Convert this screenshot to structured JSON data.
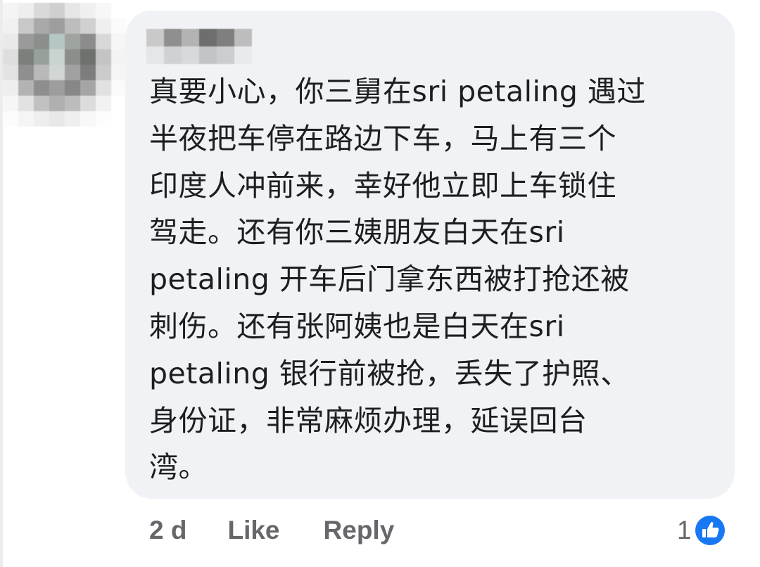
{
  "comment": {
    "lines": [
      "真要小心，你三舅在sri petaling 遇过",
      "半夜把车停在路边下车，马上有三个",
      "印度人冲前来，幸好他立即上车锁住",
      "驾走。还有你三姨朋友白天在sri",
      "petaling 开车后门拿东西被打抢还被",
      "刺伤。还有张阿姨也是白天在sri",
      "petaling 银行前被抢，丢失了护照、",
      "身份证，非常麻烦办理，延误回台",
      "湾。"
    ]
  },
  "actions": {
    "time": "2 d",
    "like_label": "Like",
    "reply_label": "Reply"
  },
  "reactions": {
    "count": "1",
    "icon": "like-thumb-icon",
    "badge_color": "#1877f2"
  },
  "colors": {
    "bubble_bg": "#f0f2f5",
    "text": "#1c1e21",
    "meta_text": "#65676b",
    "like_blue": "#1877f2"
  }
}
